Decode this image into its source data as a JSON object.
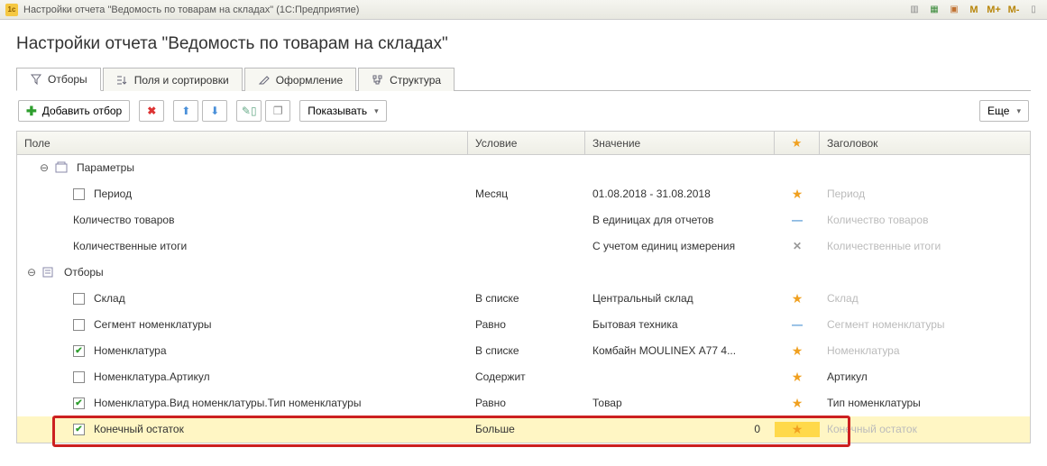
{
  "titlebar": {
    "text": "Настройки отчета \"Ведомость по товарам на складах\"  (1С:Предприятие)"
  },
  "page_title": "Настройки отчета \"Ведомость по товарам на складах\"",
  "tabs": {
    "filters": "Отборы",
    "fields": "Поля и сортировки",
    "format": "Оформление",
    "structure": "Структура"
  },
  "toolbar": {
    "add_filter": "Добавить отбор",
    "show": "Показывать",
    "more": "Еще"
  },
  "grid": {
    "headers": {
      "field": "Поле",
      "condition": "Условие",
      "value": "Значение",
      "title": "Заголовок"
    },
    "groups": {
      "params": "Параметры",
      "filters": "Отборы"
    },
    "rows": [
      {
        "field": "Период",
        "condition": "Месяц",
        "value": "01.08.2018 - 31.08.2018",
        "title": "Период",
        "star": "star",
        "title_dim": true,
        "chk": false
      },
      {
        "field": "Количество товаров",
        "condition": "",
        "value": "В единицах для отчетов",
        "title": "Количество товаров",
        "star": "dash",
        "title_dim": true
      },
      {
        "field": "Количественные итоги",
        "condition": "",
        "value": "С учетом единиц измерения",
        "title": "Количественные итоги",
        "star": "x",
        "title_dim": true
      },
      {
        "field": "Склад",
        "condition": "В списке",
        "value": "Центральный склад",
        "title": "Склад",
        "star": "star",
        "title_dim": true,
        "chk": false
      },
      {
        "field": "Сегмент номенклатуры",
        "condition": "Равно",
        "value": "Бытовая техника",
        "title": "Сегмент номенклатуры",
        "star": "dash",
        "title_dim": true,
        "chk": false
      },
      {
        "field": "Номенклатура",
        "condition": "В списке",
        "value": "Комбайн MOULINEX  А77 4...",
        "title": "Номенклатура",
        "star": "star",
        "title_dim": true,
        "chk": true
      },
      {
        "field": "Номенклатура.Артикул",
        "condition": "Содержит",
        "value": "",
        "title": "Артикул",
        "star": "star",
        "title_dim": false,
        "chk": false
      },
      {
        "field": "Номенклатура.Вид номенклатуры.Тип номенклатуры",
        "condition": "Равно",
        "value": "Товар",
        "title": "Тип номенклатуры",
        "star": "star",
        "title_dim": false,
        "chk": true
      },
      {
        "field": "Конечный остаток",
        "condition": "Больше",
        "value": "0",
        "title": "Конечный остаток",
        "star": "star-hl",
        "title_dim": true,
        "chk": true
      }
    ]
  }
}
